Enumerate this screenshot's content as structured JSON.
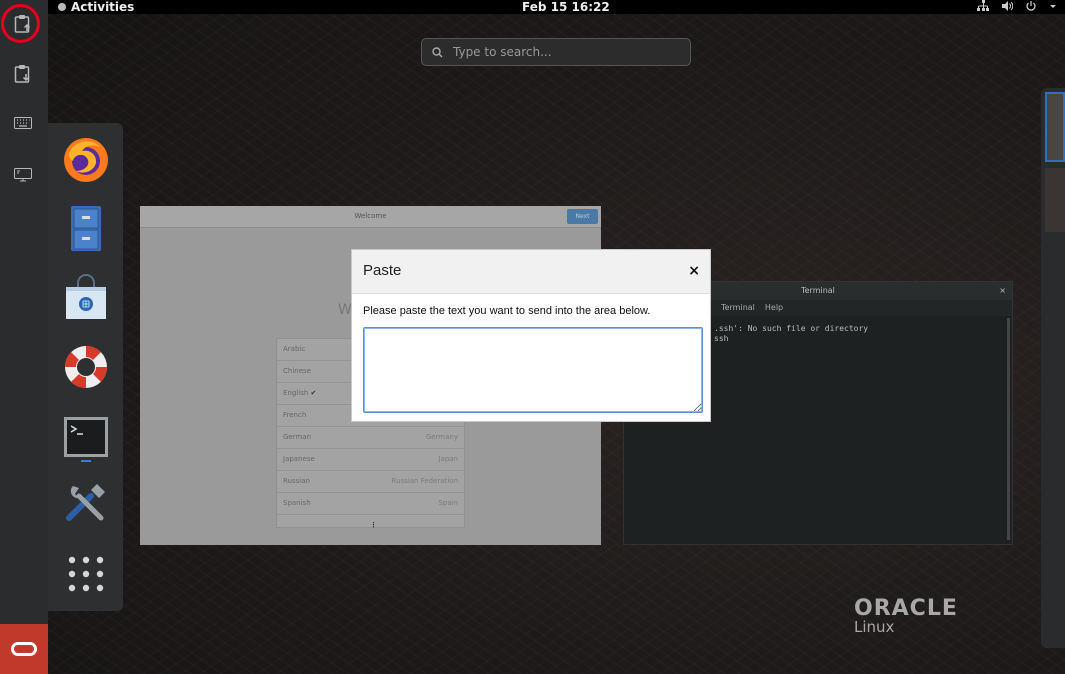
{
  "topbar": {
    "activities_label": "Activities",
    "clock": "Feb 15  16:22"
  },
  "search": {
    "placeholder": "Type to search..."
  },
  "welcome_window": {
    "title": "Welcome",
    "next_label": "Next",
    "heading_partial": "W",
    "languages": [
      {
        "name": "Arabic",
        "country": ""
      },
      {
        "name": "Chinese",
        "country": ""
      },
      {
        "name": "English",
        "country": "",
        "checked": true
      },
      {
        "name": "French",
        "country": ""
      },
      {
        "name": "German",
        "country": "Germany"
      },
      {
        "name": "Japanese",
        "country": "Japan"
      },
      {
        "name": "Russian",
        "country": "Russian Federation"
      },
      {
        "name": "Spanish",
        "country": "Spain"
      }
    ],
    "more_label": "⋮"
  },
  "terminal_window": {
    "title": "Terminal",
    "menu": [
      "h",
      "Terminal",
      "Help"
    ],
    "lines": [
      ".ssh': No such file or directory",
      "ssh"
    ]
  },
  "paste_dialog": {
    "title": "Paste",
    "close_label": "×",
    "instruction": "Please paste the text you want to send into the area below.",
    "text_value": ""
  },
  "oracle_logo": {
    "line1": "ORACLE",
    "line2": "Linux"
  },
  "colors": {
    "highlight": "#e8001c",
    "focus_border": "#5b8fd6",
    "oracle_red": "#c0392b"
  }
}
